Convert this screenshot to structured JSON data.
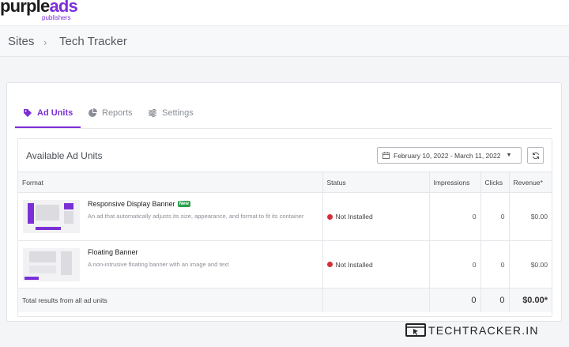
{
  "brand": {
    "name_part1": "purple",
    "name_part2": "ads",
    "sub": "publishers",
    "accent": "#7b2fd6"
  },
  "breadcrumb": {
    "root": "Sites",
    "separator": "›",
    "current": "Tech Tracker"
  },
  "tabs": [
    {
      "label": "Ad Units",
      "icon": "tags-icon",
      "active": true
    },
    {
      "label": "Reports",
      "icon": "pie-chart-icon",
      "active": false
    },
    {
      "label": "Settings",
      "icon": "sliders-icon",
      "active": false
    }
  ],
  "panel": {
    "title": "Available Ad Units",
    "date_range": "February 10, 2022 - March 11, 2022"
  },
  "table": {
    "headers": {
      "format": "Format",
      "status": "Status",
      "impressions": "Impressions",
      "clicks": "Clicks",
      "revenue": "Revenue*"
    },
    "rows": [
      {
        "name": "Responsive Display Banner",
        "badge": "New",
        "description": "An ad that automatically adjusts its size, appearance, and format to fit its container",
        "status": "Not Installed",
        "impressions": "0",
        "clicks": "0",
        "revenue": "$0.00"
      },
      {
        "name": "Floating Banner",
        "badge": "",
        "description": "A non-intrusive floating banner with an image and text",
        "status": "Not Installed",
        "impressions": "0",
        "clicks": "0",
        "revenue": "$0.00"
      }
    ],
    "total": {
      "label": "Total results from all ad units",
      "impressions": "0",
      "clicks": "0",
      "revenue": "$0.00*"
    }
  },
  "status_color": "#d32f3a",
  "watermark": "TECHTRACKER.IN"
}
